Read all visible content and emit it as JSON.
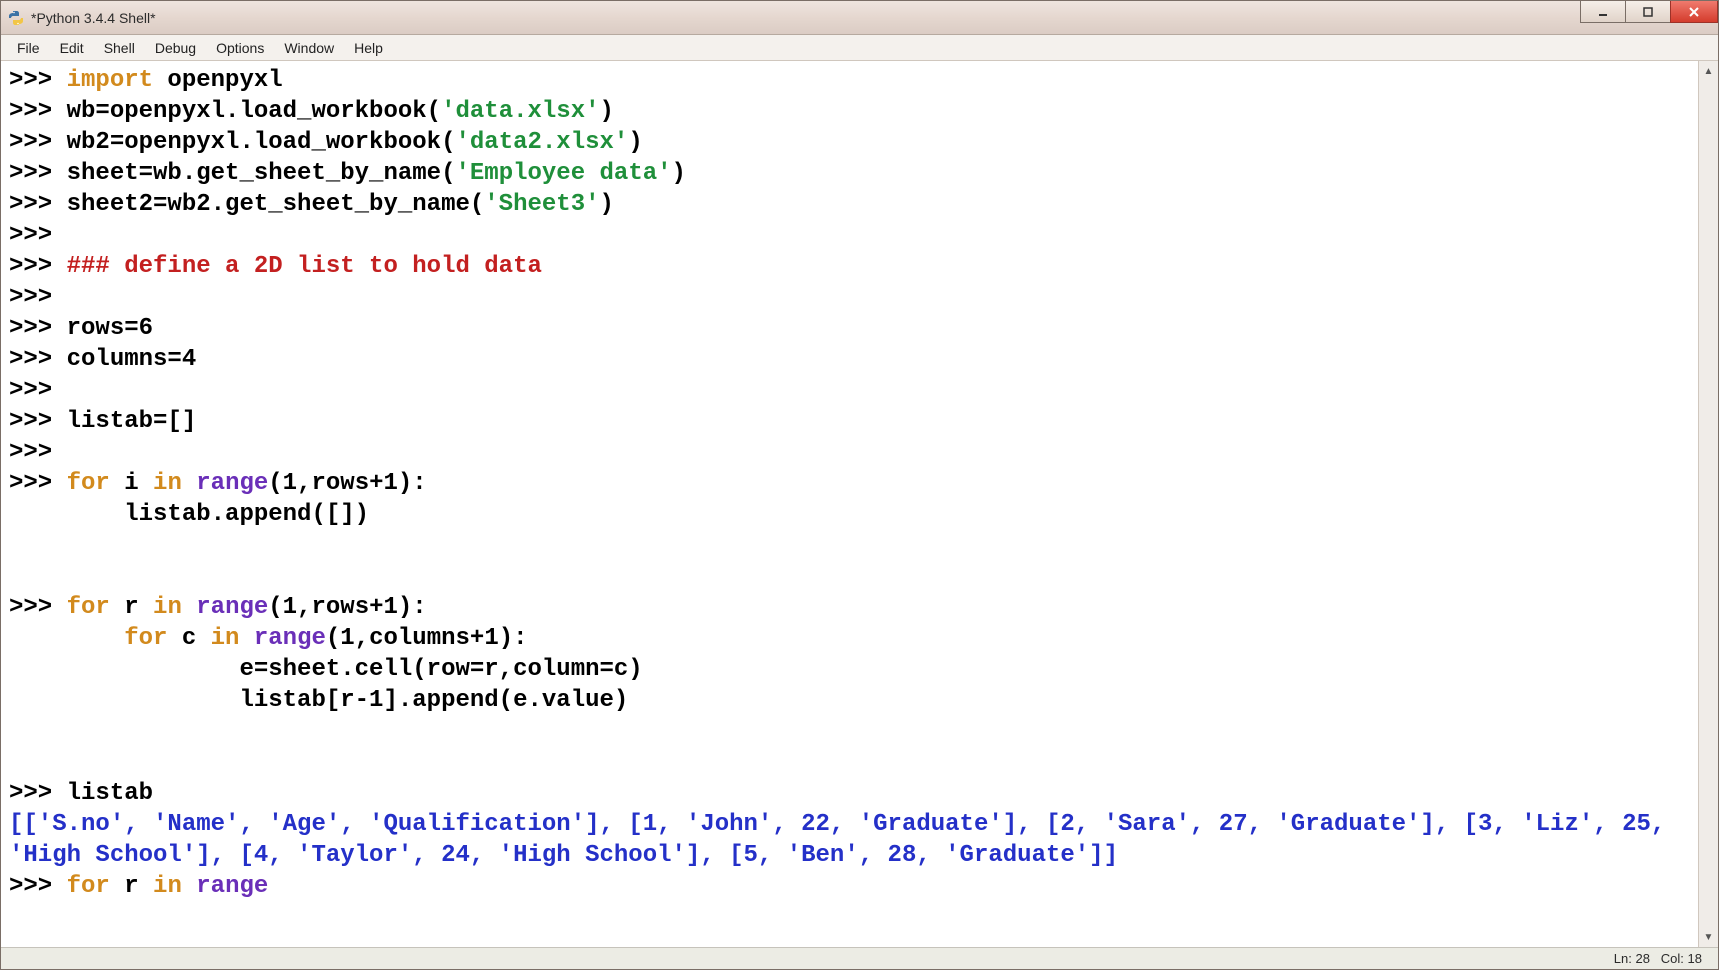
{
  "window": {
    "title": "*Python 3.4.4 Shell*"
  },
  "menu": {
    "items": [
      "File",
      "Edit",
      "Shell",
      "Debug",
      "Options",
      "Window",
      "Help"
    ]
  },
  "status": {
    "ln_label": "Ln:",
    "ln_value": "28",
    "col_label": "Col:",
    "col_value": "18"
  },
  "code": {
    "prompt": ">>> ",
    "lines": [
      {
        "type": "in",
        "segments": [
          [
            "kw",
            "import"
          ],
          [
            "prm",
            " openpyxl"
          ]
        ]
      },
      {
        "type": "in",
        "segments": [
          [
            "prm",
            "wb=openpyxl.load_workbook("
          ],
          [
            "str",
            "'data.xlsx'"
          ],
          [
            "prm",
            ")"
          ]
        ]
      },
      {
        "type": "in",
        "segments": [
          [
            "prm",
            "wb2=openpyxl.load_workbook("
          ],
          [
            "str",
            "'data2.xlsx'"
          ],
          [
            "prm",
            ")"
          ]
        ]
      },
      {
        "type": "in",
        "segments": [
          [
            "prm",
            "sheet=wb.get_sheet_by_name("
          ],
          [
            "str",
            "'Employee data'"
          ],
          [
            "prm",
            ")"
          ]
        ]
      },
      {
        "type": "in",
        "segments": [
          [
            "prm",
            "sheet2=wb2.get_sheet_by_name("
          ],
          [
            "str",
            "'Sheet3'"
          ],
          [
            "prm",
            ")"
          ]
        ]
      },
      {
        "type": "in",
        "segments": []
      },
      {
        "type": "in",
        "segments": [
          [
            "cmt",
            "### define a 2D list to hold data"
          ]
        ]
      },
      {
        "type": "in",
        "segments": []
      },
      {
        "type": "in",
        "segments": [
          [
            "prm",
            "rows=6"
          ]
        ]
      },
      {
        "type": "in",
        "segments": [
          [
            "prm",
            "columns=4"
          ]
        ]
      },
      {
        "type": "in",
        "segments": []
      },
      {
        "type": "in",
        "segments": [
          [
            "prm",
            "listab=[]"
          ]
        ]
      },
      {
        "type": "in",
        "segments": []
      },
      {
        "type": "in",
        "segments": [
          [
            "kw",
            "for"
          ],
          [
            "prm",
            " i "
          ],
          [
            "kw",
            "in"
          ],
          [
            "prm",
            " "
          ],
          [
            "pur",
            "range"
          ],
          [
            "prm",
            "(1,rows+1):"
          ]
        ]
      },
      {
        "type": "cont",
        "segments": [
          [
            "prm",
            "        listab.append([])"
          ]
        ]
      },
      {
        "type": "blank"
      },
      {
        "type": "blank"
      },
      {
        "type": "in",
        "segments": [
          [
            "kw",
            "for"
          ],
          [
            "prm",
            " r "
          ],
          [
            "kw",
            "in"
          ],
          [
            "prm",
            " "
          ],
          [
            "pur",
            "range"
          ],
          [
            "prm",
            "(1,rows+1):"
          ]
        ]
      },
      {
        "type": "cont",
        "segments": [
          [
            "prm",
            "        "
          ],
          [
            "kw",
            "for"
          ],
          [
            "prm",
            " c "
          ],
          [
            "kw",
            "in"
          ],
          [
            "prm",
            " "
          ],
          [
            "pur",
            "range"
          ],
          [
            "prm",
            "(1,columns+1):"
          ]
        ]
      },
      {
        "type": "cont",
        "segments": [
          [
            "prm",
            "                e=sheet.cell(row=r,column=c)"
          ]
        ]
      },
      {
        "type": "cont",
        "segments": [
          [
            "prm",
            "                listab[r-1].append(e.value)"
          ]
        ]
      },
      {
        "type": "blank"
      },
      {
        "type": "blank"
      },
      {
        "type": "in",
        "segments": [
          [
            "prm",
            "listab"
          ]
        ]
      },
      {
        "type": "out",
        "segments": [
          [
            "blu",
            "[['S.no', 'Name', 'Age', 'Qualification'], [1, 'John', 22, 'Graduate'], [2, 'Sara', 27, 'Graduate'], [3, 'Liz', 25, 'High School'], [4, 'Taylor', 24, 'High School'], [5, 'Ben', 28, 'Graduate']]"
          ]
        ]
      },
      {
        "type": "in",
        "segments": [
          [
            "kw",
            "for"
          ],
          [
            "prm",
            " r "
          ],
          [
            "kw",
            "in"
          ],
          [
            "prm",
            " "
          ],
          [
            "pur",
            "range"
          ]
        ]
      }
    ]
  }
}
